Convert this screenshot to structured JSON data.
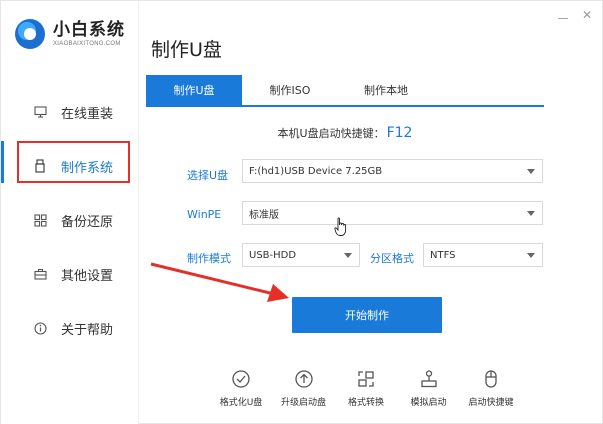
{
  "app": {
    "name_cn": "小白系统",
    "name_en": "XIAOBAIXITONG.COM"
  },
  "window_controls": {
    "close_glyph": "✕"
  },
  "sidebar": {
    "items": [
      {
        "label": "在线重装",
        "icon": "monitor-icon"
      },
      {
        "label": "制作系统",
        "icon": "usb-icon",
        "active": true
      },
      {
        "label": "备份还原",
        "icon": "backup-grid-icon"
      },
      {
        "label": "其他设置",
        "icon": "toolbox-icon"
      },
      {
        "label": "关于帮助",
        "icon": "info-icon"
      }
    ]
  },
  "main": {
    "title": "制作U盘",
    "tabs": [
      {
        "label": "制作U盘",
        "active": true
      },
      {
        "label": "制作ISO"
      },
      {
        "label": "制作本地"
      }
    ],
    "hotkey": {
      "label": "本机U盘启动快捷键：",
      "key": "F12"
    },
    "form": {
      "usb_label": "选择U盘",
      "usb_value": "F:(hd1)USB Device 7.25GB",
      "winpe_label": "WinPE",
      "winpe_value": "标准版",
      "mode_label": "制作模式",
      "mode_value": "USB-HDD",
      "fs_label": "分区格式",
      "fs_value": "NTFS"
    },
    "start_button": "开始制作",
    "tools": [
      {
        "label": "格式化U盘",
        "icon": "check-circle-icon"
      },
      {
        "label": "升级启动盘",
        "icon": "upgrade-arrow-icon"
      },
      {
        "label": "格式转换",
        "icon": "convert-icon"
      },
      {
        "label": "模拟启动",
        "icon": "joystick-icon"
      },
      {
        "label": "启动快捷键",
        "icon": "mouse-icon"
      }
    ]
  },
  "colors": {
    "accent": "#1a7ad9",
    "highlight_box": "#e5302a",
    "annotation_arrow": "#e5302a"
  }
}
